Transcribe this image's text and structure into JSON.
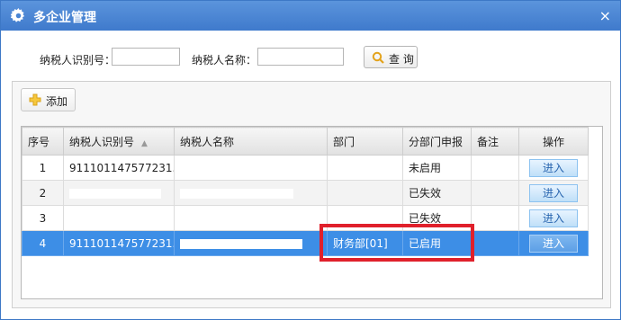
{
  "window": {
    "title": "多企业管理",
    "close_label": "×",
    "icons": {
      "settings": "gear-icon",
      "close": "close-icon"
    }
  },
  "search": {
    "taxpayer_id_label": "纳税人识别号：",
    "taxpayer_id_value": "",
    "taxpayer_name_label": "纳税人名称：",
    "taxpayer_name_value": "",
    "query_label": "查 询",
    "query_icon": "search-icon"
  },
  "toolbar": {
    "add_label": "添加",
    "add_icon": "plus-icon"
  },
  "table": {
    "columns": [
      "序号",
      "纳税人识别号",
      "纳税人名称",
      "部门",
      "分部门申报",
      "备注",
      "操作"
    ],
    "sort_indicator": "▲",
    "rows": [
      {
        "index": "1",
        "taxpayer_id": "911101147577231...",
        "name": "",
        "dept": "",
        "status": "未启用",
        "note": "",
        "action": "进入"
      },
      {
        "index": "2",
        "taxpayer_id": "",
        "name": "",
        "dept": "",
        "status": "已失效",
        "note": "",
        "action": "进入"
      },
      {
        "index": "3",
        "taxpayer_id": "",
        "name": "",
        "dept": "",
        "status": "已失效",
        "note": "",
        "action": "进入"
      },
      {
        "index": "4",
        "taxpayer_id": "911101147577231...",
        "name": "",
        "dept": "财务部[01]",
        "status": "已启用",
        "note": "",
        "action": "进入"
      }
    ],
    "selected_row": "4"
  },
  "colors": {
    "titlebar": "#4a86d4",
    "selected_row": "#3d8ee6",
    "highlight_box": "#e0202b"
  }
}
